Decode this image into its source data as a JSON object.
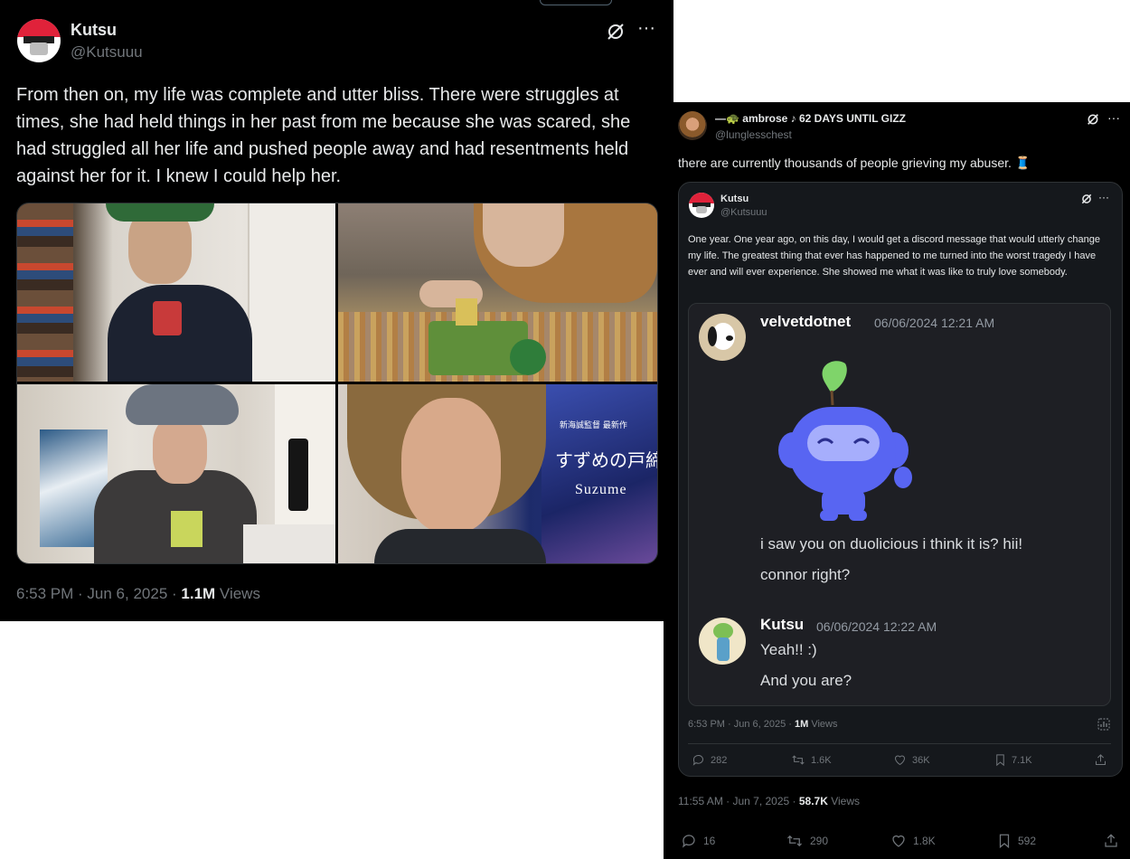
{
  "left_tweet": {
    "display_name": "Kutsu",
    "handle": "@Kutsuuu",
    "text": "From then on, my life was complete and utter bliss. There were struggles at times, she had held things in her past from me because she was scared, she had struggled all her life and pushed people away and had resentments held against her for it. I knew I could help her.",
    "time": "6:53 PM · Jun 6, 2025 · ",
    "views_count": "1.1M",
    "views_label": " Views",
    "more": "···",
    "photo_text": {
      "poster_line1": "新海誠監督 最新作",
      "poster_title": "すずめの戸締まり",
      "poster_en": "Suzume"
    }
  },
  "right_tweet": {
    "display_name": "—🐢 ambrose ♪ 62 DAYS UNTIL GIZZ",
    "handle": "@lunglesschest",
    "text": "there are currently thousands of people grieving my abuser. 🧵",
    "more": "···",
    "quoted": {
      "display_name": "Kutsu",
      "handle": "@Kutsuuu",
      "more": "···",
      "text": "One year. One year ago, on this day, I would get a discord message that would utterly change my life. The greatest thing that ever has happened to me turned into the worst tragedy I have ever and will ever experience. She showed me what it was like to truly love somebody.",
      "discord": {
        "msg1_user": "velvetdotnet",
        "msg1_time": "06/06/2024 12:21 AM",
        "msg1_line1": "i saw you on duolicious i think it is? hii!",
        "msg1_line2": "connor right?",
        "msg2_user": "Kutsu",
        "msg2_time": "06/06/2024 12:22 AM",
        "msg2_line1": "Yeah!! :)",
        "msg2_line2": "And you are?"
      },
      "time": "6:53 PM · Jun 6, 2025 · ",
      "views_count": "1M",
      "views_label": " Views",
      "actions": {
        "replies": "282",
        "reposts": "1.6K",
        "likes": "36K",
        "bookmarks": "7.1K"
      }
    },
    "time": "11:55 AM · Jun 7, 2025 · ",
    "views_count": "58.7K",
    "views_label": " Views",
    "actions": {
      "replies": "16",
      "reposts": "290",
      "likes": "1.8K",
      "bookmarks": "592"
    }
  }
}
